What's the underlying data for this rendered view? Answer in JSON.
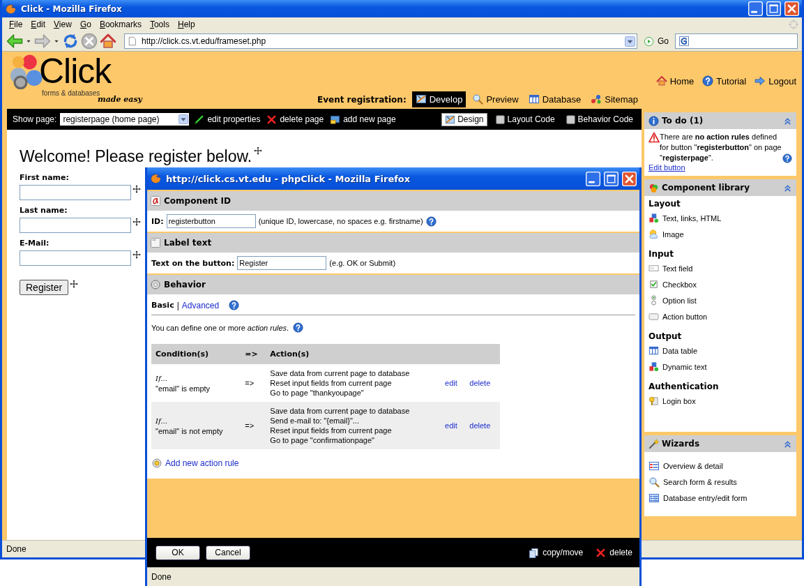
{
  "window": {
    "title": "Click - Mozilla Firefox"
  },
  "menu": [
    "File",
    "Edit",
    "View",
    "Go",
    "Bookmarks",
    "Tools",
    "Help"
  ],
  "address": {
    "value": "http://click.cs.vt.edu/frameset.php"
  },
  "go_label": "Go",
  "header": {
    "logo": "Click",
    "tagline": "forms & databases",
    "tagline_script": "made easy",
    "project_label": "Event registration:",
    "tabs": [
      {
        "label": "Develop",
        "selected": true
      },
      {
        "label": "Preview",
        "selected": false
      },
      {
        "label": "Database",
        "selected": false
      },
      {
        "label": "Sitemap",
        "selected": false
      }
    ],
    "links": [
      "Home",
      "Tutorial",
      "Logout"
    ]
  },
  "toolbar": {
    "show_page_label": "Show page:",
    "page_select": "registerpage (home page)",
    "actions": [
      "edit properties",
      "delete page",
      "add new page"
    ],
    "views": [
      {
        "label": "Design",
        "selected": true
      },
      {
        "label": "Layout Code",
        "selected": false
      },
      {
        "label": "Behavior Code",
        "selected": false
      }
    ]
  },
  "canvas": {
    "heading": "Welcome! Please register below.",
    "fields": [
      {
        "label": "First name:"
      },
      {
        "label": "Last name:"
      },
      {
        "label": "E-Mail:"
      }
    ],
    "button": "Register"
  },
  "sidebar": {
    "panels": [
      {
        "title": "To do (1)",
        "kind": "todo",
        "message": "There are **no action rules** defined for button \"**registerbutton**\" on page \"**registerpage**\".",
        "link": "Edit button"
      },
      {
        "title": "Component library",
        "kind": "library",
        "groups": [
          {
            "heading": "Layout",
            "items": [
              "Text, links, HTML",
              "Image"
            ]
          },
          {
            "heading": "Input",
            "items": [
              "Text field",
              "Checkbox",
              "Option list",
              "Action button"
            ]
          },
          {
            "heading": "Output",
            "items": [
              "Data table",
              "Dynamic text"
            ]
          },
          {
            "heading": "Authentication",
            "items": [
              "Login box"
            ]
          }
        ]
      },
      {
        "title": "Wizards",
        "kind": "wizards",
        "items": [
          "Overview & detail",
          "Search form & results",
          "Database entry/edit form"
        ]
      }
    ]
  },
  "status_bar": "Done",
  "dialog": {
    "title": "http://click.cs.vt.edu - phpClick - Mozilla Firefox",
    "sections": [
      {
        "title": "Component ID",
        "kind": "id",
        "label": "ID:",
        "value": "registerbutton",
        "hint": "(unique ID, lowercase, no spaces e.g. firstname)"
      },
      {
        "title": "Label text",
        "kind": "label",
        "label": "Text on the button:",
        "value": "Register",
        "hint": "(e.g. OK or Submit)"
      },
      {
        "title": "Behavior",
        "kind": "behavior"
      }
    ],
    "behavior": {
      "modes": [
        {
          "label": "Basic",
          "selected": true
        },
        {
          "label": "Advanced",
          "selected": false
        }
      ],
      "separator": "|",
      "intro": "You can define one or more *action rules*.",
      "columns": [
        "Condition(s)",
        "=>",
        "Action(s)"
      ],
      "rules": [
        {
          "if": "If...",
          "condition": "\"email\" is empty",
          "arrow": "=>",
          "actions": [
            "Save data from current page to database",
            "Reset input fields from current page",
            "Go to page \"thankyoupage\""
          ],
          "edit": "edit",
          "delete": "delete"
        },
        {
          "if": "If...",
          "condition": "\"email\" is not empty",
          "arrow": "=>",
          "actions": [
            "Save data from current page to database",
            "Send e-mail to: \"{email}\"...",
            "Reset input fields from current page",
            "Go to page \"confirmationpage\""
          ],
          "edit": "edit",
          "delete": "delete"
        }
      ],
      "add": "Add new action rule"
    },
    "buttons": [
      "OK",
      "Cancel"
    ],
    "actions": [
      "copy/move",
      "delete"
    ],
    "status": "Done"
  }
}
